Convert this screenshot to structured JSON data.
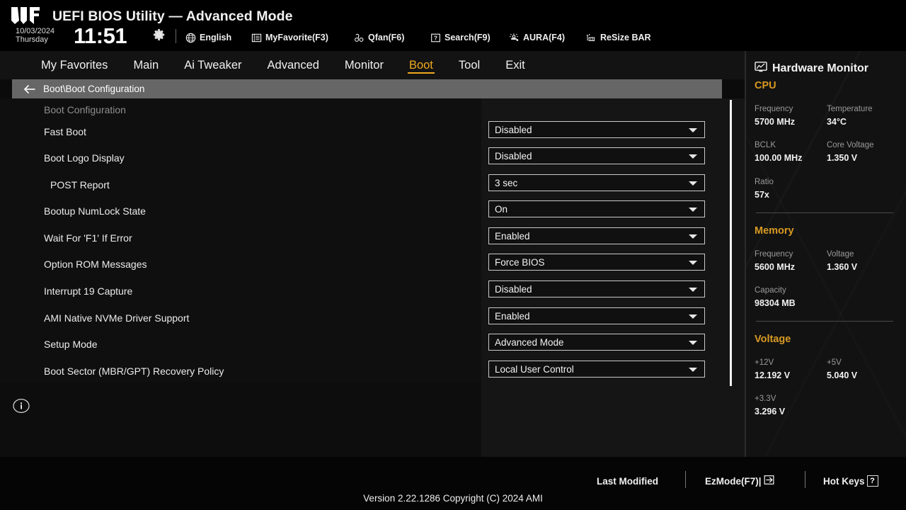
{
  "header": {
    "logo": "tuf-gaming-logo",
    "title": "UEFI BIOS Utility — Advanced Mode",
    "date": "10/03/2024",
    "weekday": "Thursday",
    "time": "11:51",
    "gear_icon": "gear-icon",
    "items": [
      {
        "icon": "globe-icon",
        "label": "English"
      },
      {
        "icon": "list-icon",
        "label": "MyFavorite(F3)"
      },
      {
        "icon": "fan-icon",
        "label": "Qfan(F6)"
      },
      {
        "icon": "question-icon",
        "label": "Search(F9)"
      },
      {
        "icon": "aura-icon",
        "label": "AURA(F4)"
      },
      {
        "icon": "resizebar-icon",
        "label": "ReSize BAR"
      }
    ]
  },
  "tabs": [
    {
      "label": "My Favorites",
      "active": false
    },
    {
      "label": "Main",
      "active": false
    },
    {
      "label": "Ai Tweaker",
      "active": false
    },
    {
      "label": "Advanced",
      "active": false
    },
    {
      "label": "Monitor",
      "active": false
    },
    {
      "label": "Boot",
      "active": true
    },
    {
      "label": "Tool",
      "active": false
    },
    {
      "label": "Exit",
      "active": false
    }
  ],
  "breadcrumb": {
    "back_icon": "back-arrow-icon",
    "path": "Boot\\Boot Configuration"
  },
  "main": {
    "group_title": "Boot Configuration",
    "rows": [
      {
        "label": "Fast Boot",
        "value": "Disabled",
        "sub": false
      },
      {
        "label": "Boot Logo Display",
        "value": "Disabled",
        "sub": false
      },
      {
        "label": "POST Report",
        "value": "3 sec",
        "sub": true
      },
      {
        "label": "Bootup NumLock State",
        "value": "On",
        "sub": false
      },
      {
        "label": "Wait For 'F1' If Error",
        "value": "Enabled",
        "sub": false
      },
      {
        "label": "Option ROM Messages",
        "value": "Force BIOS",
        "sub": false
      },
      {
        "label": "Interrupt 19 Capture",
        "value": "Disabled",
        "sub": false
      },
      {
        "label": "AMI Native NVMe Driver Support",
        "value": "Enabled",
        "sub": false
      },
      {
        "label": "Setup Mode",
        "value": "Advanced Mode",
        "sub": false
      },
      {
        "label": "Boot Sector (MBR/GPT) Recovery Policy",
        "value": "Local User Control",
        "sub": false
      }
    ],
    "info_icon": "info-icon"
  },
  "hardware_monitor": {
    "icon": "monitor-icon",
    "title": "Hardware Monitor",
    "sections": [
      {
        "name": "CPU",
        "fields": [
          {
            "label": "Frequency",
            "value": "5700 MHz"
          },
          {
            "label": "Temperature",
            "value": "34°C"
          },
          {
            "label": "BCLK",
            "value": "100.00 MHz"
          },
          {
            "label": "Core Voltage",
            "value": "1.350 V"
          },
          {
            "label": "Ratio",
            "value": "57x"
          }
        ]
      },
      {
        "name": "Memory",
        "fields": [
          {
            "label": "Frequency",
            "value": "5600 MHz"
          },
          {
            "label": "Voltage",
            "value": "1.360 V"
          },
          {
            "label": "Capacity",
            "value": "98304 MB"
          }
        ]
      },
      {
        "name": "Voltage",
        "fields": [
          {
            "label": "+12V",
            "value": "12.192 V"
          },
          {
            "label": "+5V",
            "value": "5.040 V"
          },
          {
            "label": "+3.3V",
            "value": "3.296 V"
          }
        ]
      }
    ]
  },
  "footer": {
    "last_modified": "Last Modified",
    "ezmode": "EzMode(F7)|",
    "ezmode_icon": "exit-arrow-icon",
    "hotkeys": "Hot Keys",
    "hotkeys_key": "?",
    "version": "Version 2.22.1286 Copyright (C) 2024 AMI"
  },
  "colors": {
    "accent": "#f0a81e",
    "hw_accent": "#d99a23",
    "background": "#0b0b0b",
    "panel": "#121212"
  }
}
